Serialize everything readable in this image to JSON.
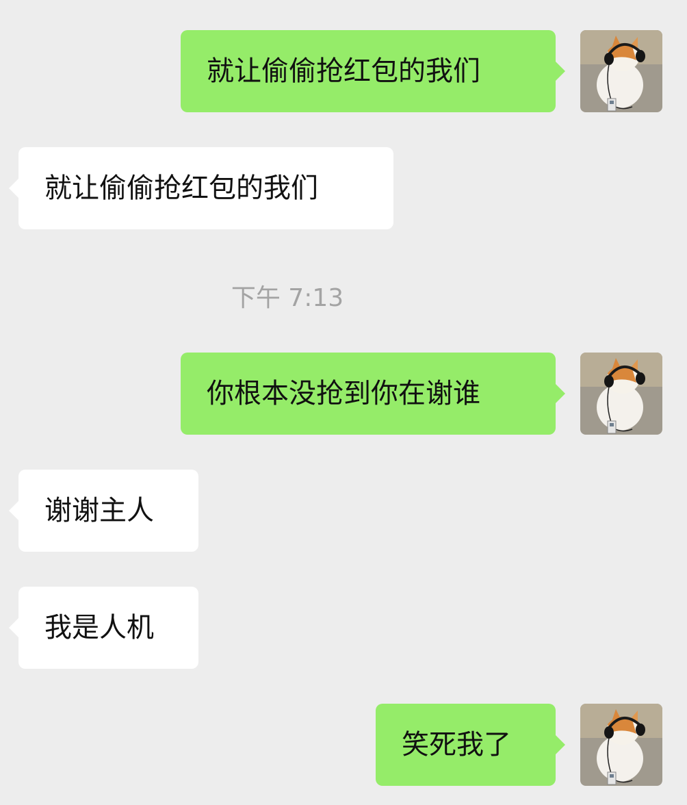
{
  "chat": {
    "messages": [
      {
        "sender": "self",
        "text": "就让偷偷抢红包的我们"
      },
      {
        "sender": "other",
        "text": "就让偷偷抢红包的我们"
      },
      {
        "type": "timestamp",
        "text": "下午 7:13"
      },
      {
        "sender": "self",
        "text": "你根本没抢到你在谢谁"
      },
      {
        "sender": "other",
        "text": "谢谢主人"
      },
      {
        "sender": "other",
        "text": "我是人机"
      },
      {
        "sender": "self",
        "text": "笑死我了"
      }
    ]
  },
  "avatar": {
    "icon": "cat-with-headphones-avatar"
  },
  "colors": {
    "background": "#ededed",
    "outgoing_bubble": "#95ec69",
    "incoming_bubble": "#ffffff",
    "timestamp_text": "#a3a3a3"
  }
}
